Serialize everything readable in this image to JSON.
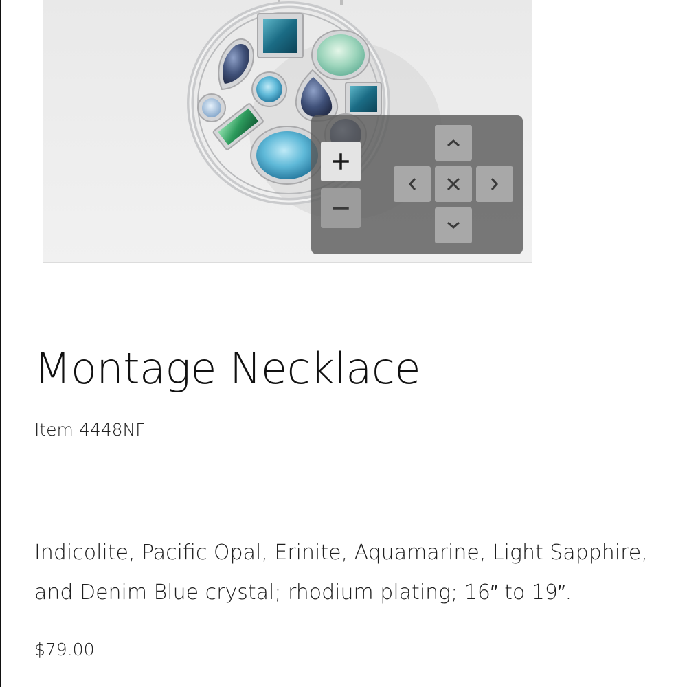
{
  "product": {
    "title": "Montage Necklace",
    "item_number": "Item 4448NF",
    "description": "Indicolite, Pacific Opal, Erinite, Aquamarine, Light Sapphire, and Denim Blue crystal; rhodium plating; 16″ to 19″.",
    "price": "$79.00"
  },
  "image": {
    "subject": "circular pendant with assorted crystals",
    "colors": {
      "background": "#ebebeb",
      "metal": "#d9dadc",
      "indicolite": "#1f6e86",
      "pacific_opal": "#9ed4bd",
      "erinite": "#2e9a5e",
      "aquamarine": "#6fc3df",
      "light_sapphire": "#a9c6e0",
      "denim_blue": "#3d4f74"
    }
  },
  "zoom_controls": {
    "zoom_in": "plus-icon",
    "zoom_out": "minus-icon",
    "pan_up": "chevron-up-icon",
    "pan_down": "chevron-down-icon",
    "pan_left": "chevron-left-icon",
    "pan_right": "chevron-right-icon",
    "reset": "close-icon"
  }
}
